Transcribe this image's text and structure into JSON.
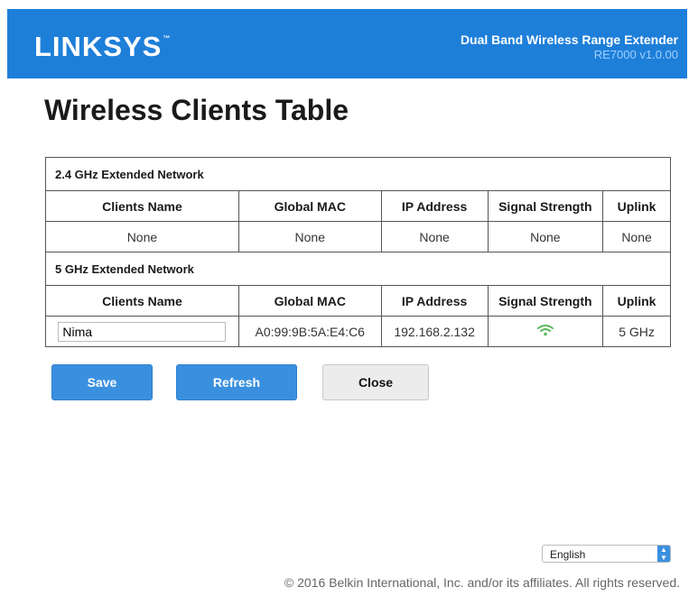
{
  "header": {
    "logo": "LINKSYS",
    "logo_tm": "™",
    "product_name": "Dual Band Wireless Range Extender",
    "version": "RE7000 v1.0.00"
  },
  "page_title": "Wireless Clients Table",
  "columns": [
    "Clients Name",
    "Global MAC",
    "IP Address",
    "Signal Strength",
    "Uplink"
  ],
  "networks": [
    {
      "title": "2.4 GHz Extended Network",
      "rows": [
        {
          "name": "None",
          "mac": "None",
          "ip": "None",
          "signal": "None",
          "uplink": "None"
        }
      ]
    },
    {
      "title": "5 GHz Extended Network",
      "rows": [
        {
          "name": "Nima",
          "mac": "A0:99:9B:5A:E4:C6",
          "ip": "192.168.2.132",
          "signal_icon": "wifi-signal-icon",
          "signal_color": "#5cb85c",
          "uplink": "5 GHz"
        }
      ]
    }
  ],
  "buttons": {
    "save": "Save",
    "refresh": "Refresh",
    "close": "Close"
  },
  "language": {
    "selected": "English"
  },
  "footer": {
    "copyright": "© 2016 Belkin International, Inc. and/or its affiliates. All rights reserved."
  },
  "colors": {
    "brand_blue": "#1e7fd9",
    "button_blue": "#3a90df"
  }
}
